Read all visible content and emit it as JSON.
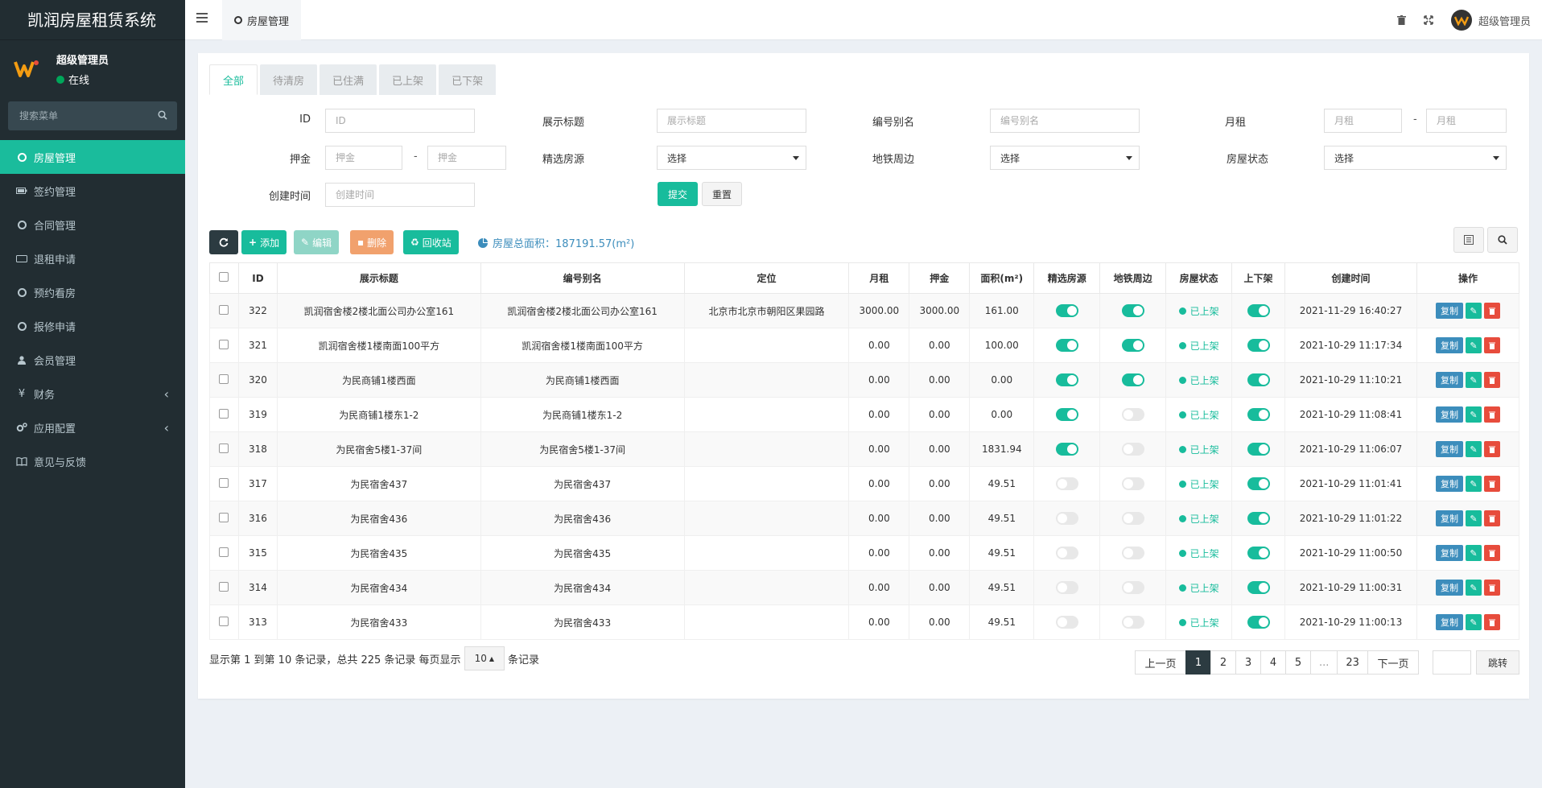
{
  "app": {
    "title": "凯润房屋租赁系统"
  },
  "user": {
    "name": "超级管理员",
    "status": "在线"
  },
  "sidebar": {
    "search_placeholder": "搜索菜单",
    "items": [
      {
        "label": "房屋管理",
        "icon": "circle-icon",
        "active": true
      },
      {
        "label": "签约管理",
        "icon": "battery-icon"
      },
      {
        "label": "合同管理",
        "icon": "circle-icon"
      },
      {
        "label": "退租申请",
        "icon": "rectangle-icon"
      },
      {
        "label": "预约看房",
        "icon": "circle-icon"
      },
      {
        "label": "报修申请",
        "icon": "circle-icon"
      },
      {
        "label": "会员管理",
        "icon": "user-icon"
      },
      {
        "label": "财务",
        "icon": "yen-icon",
        "expandable": true
      },
      {
        "label": "应用配置",
        "icon": "gears-icon",
        "expandable": true
      },
      {
        "label": "意见与反馈",
        "icon": "book-icon"
      }
    ]
  },
  "topbar": {
    "tab": "房屋管理",
    "user": "超级管理员"
  },
  "filter_tabs": [
    "全部",
    "待清房",
    "已住满",
    "已上架",
    "已下架"
  ],
  "filters": {
    "id_label": "ID",
    "id_placeholder": "ID",
    "title_label": "展示标题",
    "title_placeholder": "展示标题",
    "alias_label": "编号别名",
    "alias_placeholder": "编号别名",
    "rent_label": "月租",
    "rent_placeholder": "月租",
    "deposit_label": "押金",
    "deposit_placeholder": "押金",
    "featured_label": "精选房源",
    "featured_value": "选择",
    "metro_label": "地铁周边",
    "metro_value": "选择",
    "status_label": "房屋状态",
    "status_value": "选择",
    "created_label": "创建时间",
    "created_placeholder": "创建时间",
    "range_dash": "-",
    "submit": "提交",
    "reset": "重置"
  },
  "toolbar": {
    "add": "添加",
    "edit": "编辑",
    "delete": "删除",
    "recycle": "回收站",
    "area_note": "房屋总面积：187191.57(m²)"
  },
  "table": {
    "headers": [
      "ID",
      "展示标题",
      "编号别名",
      "定位",
      "月租",
      "押金",
      "面积(m²)",
      "精选房源",
      "地铁周边",
      "房屋状态",
      "上下架",
      "创建时间",
      "操作"
    ],
    "rows": [
      {
        "id": "322",
        "title": "凯润宿舍楼2楼北面公司办公室161",
        "alias": "凯润宿舍楼2楼北面公司办公室161",
        "location": "北京市北京市朝阳区果园路",
        "rent": "3000.00",
        "deposit": "3000.00",
        "area": "161.00",
        "featured": true,
        "metro": true,
        "status": "已上架",
        "listed": true,
        "created": "2021-11-29 16:40:27"
      },
      {
        "id": "321",
        "title": "凯润宿舍楼1楼南面100平方",
        "alias": "凯润宿舍楼1楼南面100平方",
        "location": "",
        "rent": "0.00",
        "deposit": "0.00",
        "area": "100.00",
        "featured": true,
        "metro": true,
        "status": "已上架",
        "listed": true,
        "created": "2021-10-29 11:17:34"
      },
      {
        "id": "320",
        "title": "为民商铺1楼西面",
        "alias": "为民商铺1楼西面",
        "location": "",
        "rent": "0.00",
        "deposit": "0.00",
        "area": "0.00",
        "featured": true,
        "metro": true,
        "status": "已上架",
        "listed": true,
        "created": "2021-10-29 11:10:21"
      },
      {
        "id": "319",
        "title": "为民商铺1楼东1-2",
        "alias": "为民商铺1楼东1-2",
        "location": "",
        "rent": "0.00",
        "deposit": "0.00",
        "area": "0.00",
        "featured": true,
        "metro": false,
        "status": "已上架",
        "listed": true,
        "created": "2021-10-29 11:08:41"
      },
      {
        "id": "318",
        "title": "为民宿舍5楼1-37间",
        "alias": "为民宿舍5楼1-37间",
        "location": "",
        "rent": "0.00",
        "deposit": "0.00",
        "area": "1831.94",
        "featured": true,
        "metro": false,
        "status": "已上架",
        "listed": true,
        "created": "2021-10-29 11:06:07"
      },
      {
        "id": "317",
        "title": "为民宿舍437",
        "alias": "为民宿舍437",
        "location": "",
        "rent": "0.00",
        "deposit": "0.00",
        "area": "49.51",
        "featured": false,
        "metro": false,
        "status": "已上架",
        "listed": true,
        "created": "2021-10-29 11:01:41"
      },
      {
        "id": "316",
        "title": "为民宿舍436",
        "alias": "为民宿舍436",
        "location": "",
        "rent": "0.00",
        "deposit": "0.00",
        "area": "49.51",
        "featured": false,
        "metro": false,
        "status": "已上架",
        "listed": true,
        "created": "2021-10-29 11:01:22"
      },
      {
        "id": "315",
        "title": "为民宿舍435",
        "alias": "为民宿舍435",
        "location": "",
        "rent": "0.00",
        "deposit": "0.00",
        "area": "49.51",
        "featured": false,
        "metro": false,
        "status": "已上架",
        "listed": true,
        "created": "2021-10-29 11:00:50"
      },
      {
        "id": "314",
        "title": "为民宿舍434",
        "alias": "为民宿舍434",
        "location": "",
        "rent": "0.00",
        "deposit": "0.00",
        "area": "49.51",
        "featured": false,
        "metro": false,
        "status": "已上架",
        "listed": true,
        "created": "2021-10-29 11:00:31"
      },
      {
        "id": "313",
        "title": "为民宿舍433",
        "alias": "为民宿舍433",
        "location": "",
        "rent": "0.00",
        "deposit": "0.00",
        "area": "49.51",
        "featured": false,
        "metro": false,
        "status": "已上架",
        "listed": true,
        "created": "2021-10-29 11:00:13"
      }
    ],
    "op_copy": "复制"
  },
  "footer": {
    "info": "显示第 1 到第 10 条记录，总共 225 条记录 每页显示",
    "page_size": "10",
    "records": "条记录",
    "prev": "上一页",
    "pages": [
      "1",
      "2",
      "3",
      "4",
      "5",
      "...",
      "23"
    ],
    "current_page": "1",
    "next": "下一页",
    "jump": "跳转"
  },
  "colors": {
    "accent": "#1abc9c",
    "sidebar": "#222d32",
    "danger": "#e74c3c",
    "warning": "#f39c12",
    "info": "#3c8dbc"
  }
}
